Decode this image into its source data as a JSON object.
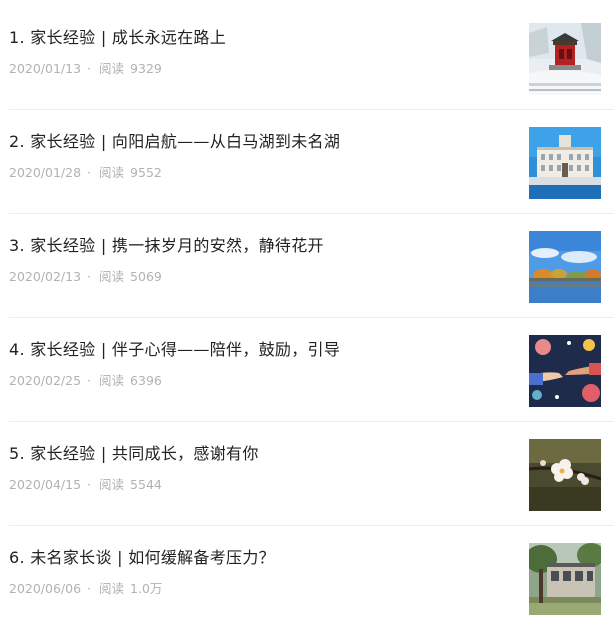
{
  "articles": [
    {
      "title": "1. 家长经验 | 成长永远在路上",
      "date": "2020/01/13",
      "views_label": "阅读",
      "views": "9329",
      "image": "red-pavilion-in-snow"
    },
    {
      "title": "2. 家长经验 | 向阳启航——从白马湖到未名湖",
      "date": "2020/01/28",
      "views_label": "阅读",
      "views": "9552",
      "image": "campus-building-blue-sky"
    },
    {
      "title": "3. 家长经验 | 携一抹岁月的安然，静待花开",
      "date": "2020/02/13",
      "views_label": "阅读",
      "views": "5069",
      "image": "lake-with-autumn-trees"
    },
    {
      "title": "4. 家长经验 | 伴子心得——陪伴，鼓励，引导",
      "date": "2020/02/25",
      "views_label": "阅读",
      "views": "6396",
      "image": "holding-hands-illustration"
    },
    {
      "title": "5. 家长经验 | 共同成长，感谢有你",
      "date": "2020/04/15",
      "views_label": "阅读",
      "views": "5544",
      "image": "white-blossom-branch"
    },
    {
      "title": "6. 未名家长谈 | 如何缓解备考压力？",
      "date": "2020/06/06",
      "views_label": "阅读",
      "views": "1.0万",
      "image": "old-building-with-trees"
    }
  ],
  "separator": "·"
}
